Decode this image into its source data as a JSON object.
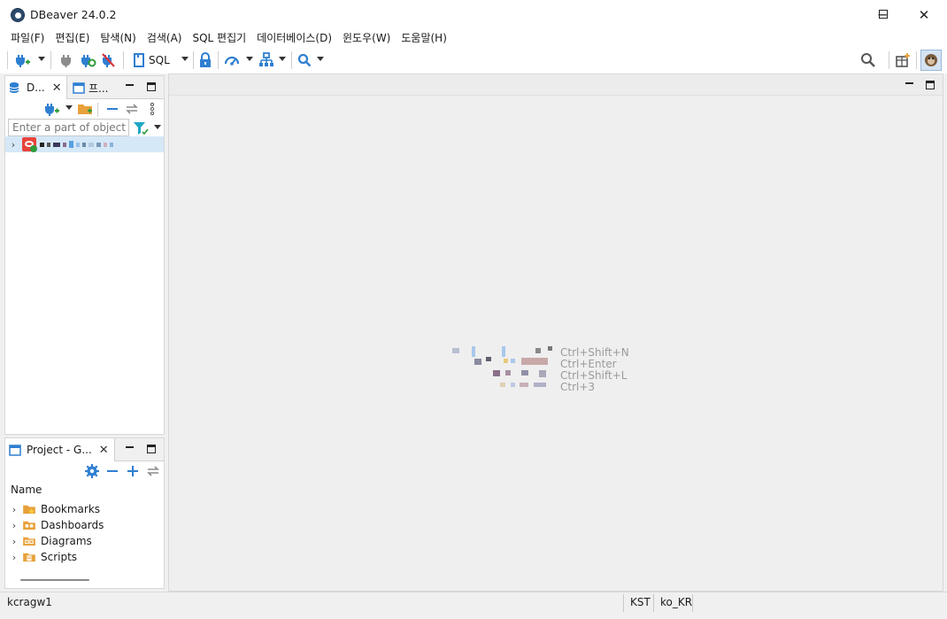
{
  "window": {
    "title": "DBeaver 24.0.2",
    "controls": {
      "minimize": "─",
      "maximize": "☐",
      "close": "✕"
    }
  },
  "menu": [
    "파일(F)",
    "편집(E)",
    "탐색(N)",
    "검색(A)",
    "SQL 편집기",
    "데이터베이스(D)",
    "윈도우(W)",
    "도움말(H)"
  ],
  "toolbar": {
    "sql_label": "SQL",
    "icons": [
      "new-connection-icon",
      "disconnect-icon",
      "reconnect-icon",
      "disconnect-all-icon",
      "sql-editor-icon",
      "lock-icon",
      "dashboard-icon",
      "schema-icon",
      "search-icon",
      "global-search-icon",
      "perspective-add-icon",
      "dbeaver-perspective-icon"
    ]
  },
  "navigator": {
    "tab_label": "D...",
    "tab2_label": "프...",
    "filter_placeholder": "Enter a part of object na",
    "accent": "#e8433a"
  },
  "project": {
    "tab_label": "Project - G...",
    "column_header": "Name",
    "items": [
      "Bookmarks",
      "Dashboards",
      "Diagrams",
      "Scripts"
    ],
    "folder_color": "#e8a13a"
  },
  "editor": {
    "shortcuts": [
      "Ctrl+Shift+N",
      "Ctrl+Enter",
      "Ctrl+Shift+L",
      "Ctrl+3"
    ]
  },
  "status": {
    "user": "kcragw1",
    "timezone": "KST",
    "locale": "ko_KR"
  },
  "colors": {
    "accent_blue": "#2f7fd1",
    "selection": "#d5e8f8"
  }
}
